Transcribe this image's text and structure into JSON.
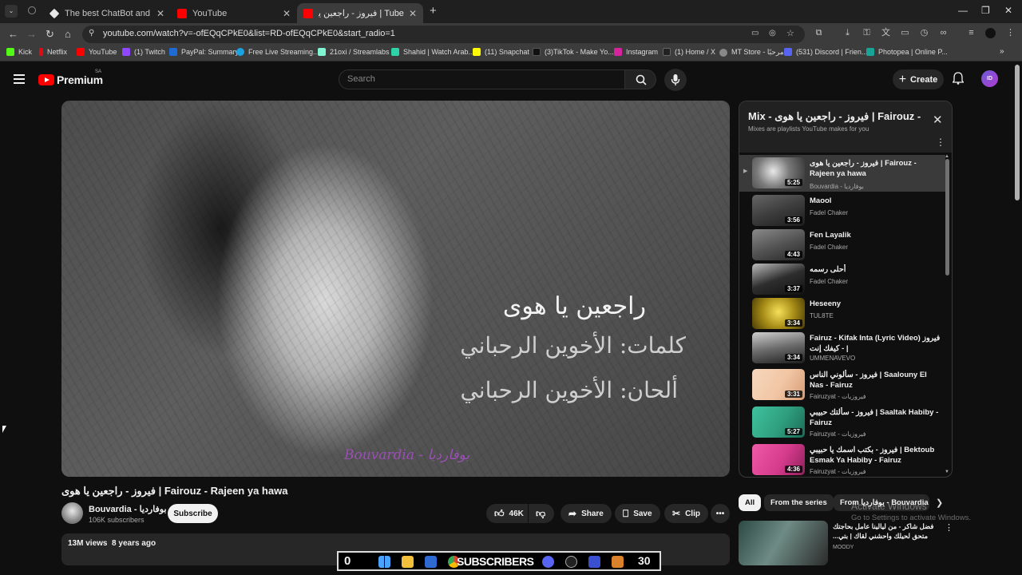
{
  "browser": {
    "tabs": [
      {
        "title": "The best ChatBot and Widgets",
        "active": false
      },
      {
        "title": "YouTube",
        "active": false
      },
      {
        "title": "Tube | فيروز - راجعين يا هوى",
        "active": true
      }
    ],
    "new_tab": "+",
    "url": "youtube.com/watch?v=-ofEQqCPkE0&list=RD-ofEQqCPkE0&start_radio=1",
    "bookmarks": [
      {
        "label": "Kick",
        "color": "#53fc18"
      },
      {
        "label": "Netflix",
        "color": "#e50914"
      },
      {
        "label": "YouTube",
        "color": "#ff0000"
      },
      {
        "label": "(1) Twitch",
        "color": "#9146ff"
      },
      {
        "label": "PayPal: Summary",
        "color": "#1f6bd6"
      },
      {
        "label": "Free Live Streaming...",
        "color": "#1ba1e2"
      },
      {
        "label": "21oxi / Streamlabs",
        "color": "#80f5d2"
      },
      {
        "label": "Shahid | Watch Arab...",
        "color": "#2fd3a8"
      },
      {
        "label": "(11) Snapchat",
        "color": "#fffc00"
      },
      {
        "label": "(3)TikTok - Make Yo...",
        "color": "#111111"
      },
      {
        "label": "Instagram",
        "color": "#d6249f"
      },
      {
        "label": "(1) Home / X",
        "color": "#222222"
      },
      {
        "label": "MT Store - مرحبًا",
        "color": "#888888"
      },
      {
        "label": "(531) Discord | Frien...",
        "color": "#5865f2"
      },
      {
        "label": "Photopea | Online P...",
        "color": "#18a497"
      }
    ]
  },
  "masthead": {
    "logo_word": "Premium",
    "region": "SA",
    "search_placeholder": "Search",
    "create_label": "Create",
    "avatar_initials": "ID"
  },
  "video": {
    "overlay_title": "راجعين يا هوى",
    "overlay_words": "كلمات: الأخوين الرحباني",
    "overlay_music": "ألحان: الأخوين الرحباني",
    "watermark": "Bouvardia - بوفارديا",
    "title": "فيروز - راجعين يا هوى | Fairouz - Rajeen ya hawa",
    "channel": "Bouvardia - بوفارديا",
    "subscribers": "106K subscribers",
    "subscribe_label": "Subscribe",
    "likes": "46K",
    "share_label": "Share",
    "save_label": "Save",
    "clip_label": "Clip",
    "views": "13M views",
    "age": "8 years ago"
  },
  "playlist": {
    "title": "Mix - فيروز - راجعين يا هوى | Fairouz - Rajeen ya hawa",
    "subtitle": "Mixes are playlists YouTube makes for you",
    "items": [
      {
        "title": "فيروز - راجعين يا هوى | Fairouz - Rajeen ya hawa",
        "channel": "Bouvardia - بوفارديا",
        "duration": "5:25",
        "current": true,
        "thumb": "#7a7a7a"
      },
      {
        "title": "Maool",
        "channel": "Fadel Chaker",
        "duration": "3:56",
        "current": false,
        "thumb": "#3d3d3d"
      },
      {
        "title": "Fen Layalik",
        "channel": "Fadel Chaker",
        "duration": "4:43",
        "current": false,
        "thumb": "#545454"
      },
      {
        "title": "أحلى رسمه",
        "channel": "Fadel Chaker",
        "duration": "3:37",
        "current": false,
        "thumb": "#2e2e2e"
      },
      {
        "title": "Heseeny",
        "channel": "TUL8TE",
        "duration": "3:34",
        "current": false,
        "thumb": "#a78d17"
      },
      {
        "title": "Fairuz - Kifak Inta (Lyric Video) فيروز - كيفك إنت |",
        "channel": "UMMENAVEVO",
        "duration": "3:34",
        "current": false,
        "thumb": "#6b6b6b"
      },
      {
        "title": "فيروز - سألوني الناس | Saalouny El Nas - Fairuz",
        "channel": "Fairuzyat - فيروزيات",
        "duration": "3:31",
        "current": false,
        "thumb": "#f1c6a4"
      },
      {
        "title": "فيروز - سألتك حبيبي | Saaltak Habiby - Fairuz",
        "channel": "Fairuzyat - فيروزيات",
        "duration": "5:27",
        "current": false,
        "thumb": "#2f9e7f"
      },
      {
        "title": "فيروز - بكتب اسمك يا حبيبي | Bektoub Esmak Ya Habiby - Fairuz",
        "channel": "Fairuzyat - فيروزيات",
        "duration": "4:36",
        "current": false,
        "thumb": "#d63c8d"
      }
    ]
  },
  "chips": [
    {
      "label": "All",
      "selected": true
    },
    {
      "label": "From the series",
      "selected": false
    },
    {
      "label": "From بوفارديا - Bouvardia",
      "selected": false
    }
  ],
  "related": {
    "title": "فضل شاكر - من ليالينا عامل بحاجتك متحق لحيلك واحشني لقاك | بتي...",
    "channel": "MOODY"
  },
  "windows_notice": {
    "line1": "Activate Windows",
    "line2": "Go to Settings to activate Windows."
  },
  "taskbar": {
    "left_text": "0",
    "banner": "SUBSCRIBERS",
    "count": "30"
  },
  "colors": {
    "accent": "#ff0000",
    "bg": "#0f0f0f",
    "panel": "#212121"
  }
}
